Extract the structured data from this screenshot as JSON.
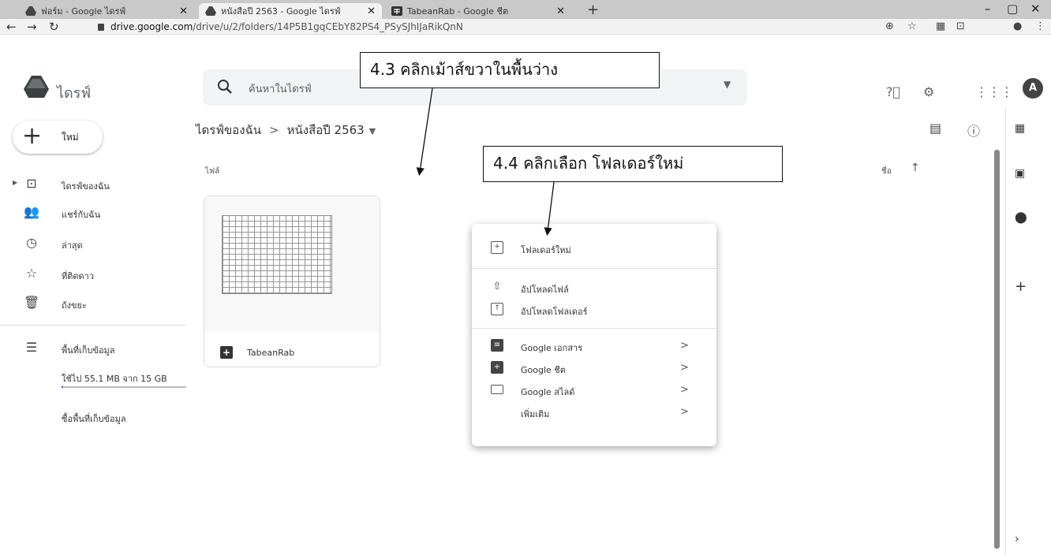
{
  "browser": {
    "tabs": [
      {
        "title": "ฟอร์ม - Google ไดรฟ์"
      },
      {
        "title": "หนังสือปี 2563 - Google ไดรฟ์"
      },
      {
        "title": "TabeanRab - Google ชีต"
      }
    ],
    "url_host": "drive.google.com",
    "url_path": "/drive/u/2/folders/14P5B1gqCEbY82PS4_PSySJhIJaRikQnN"
  },
  "drive": {
    "brand": "ไดรฟ์",
    "search_placeholder": "ค้นหาในไดรฟ์",
    "avatar_letter": "A",
    "new_button": "ใหม่",
    "sidebar": {
      "items": [
        {
          "label": "ไดรฟ์ของฉัน",
          "icon": "my-drive-icon"
        },
        {
          "label": "แชร์กับฉัน",
          "icon": "shared-icon"
        },
        {
          "label": "ล่าสุด",
          "icon": "clock-icon"
        },
        {
          "label": "ที่ติดดาว",
          "icon": "star-icon"
        },
        {
          "label": "ถังขยะ",
          "icon": "trash-icon"
        }
      ],
      "storage_label": "พื้นที่เก็บข้อมูล",
      "storage_used": "ใช้ไป 55.1 MB จาก 15 GB",
      "storage_fraction": 0.004,
      "buy_storage": "ซื้อพื้นที่เก็บข้อมูล"
    },
    "breadcrumb": {
      "root": "ไดรฟ์ของฉัน",
      "separator": ">",
      "current": "หนังสือปี 2563"
    },
    "section_label": "ไฟล์",
    "sort_label": "ชื่อ",
    "file": {
      "name": "TabeanRab"
    }
  },
  "context_menu": {
    "items": [
      {
        "label": "โฟลเดอร์ใหม่",
        "icon": "new-folder-icon"
      },
      {
        "label": "อัปโหลดไฟล์",
        "icon": "file-upload-icon"
      },
      {
        "label": "อัปโหลดโฟลเดอร์",
        "icon": "folder-upload-icon"
      },
      {
        "label": "Google เอกสาร",
        "icon": "google-docs-icon",
        "submenu": ">"
      },
      {
        "label": "Google ชีต",
        "icon": "google-sheets-icon",
        "submenu": ">"
      },
      {
        "label": "Google สไลด์",
        "icon": "google-slides-icon",
        "submenu": ">"
      },
      {
        "label": "เพิ่มเติม",
        "icon": "",
        "submenu": ">"
      }
    ]
  },
  "annotations": {
    "step_3": "4.3 คลิกเม้าส์ขวาในพื้นว่าง",
    "step_4": "4.4 คลิกเลือก โฟลเดอร์ใหม่"
  }
}
